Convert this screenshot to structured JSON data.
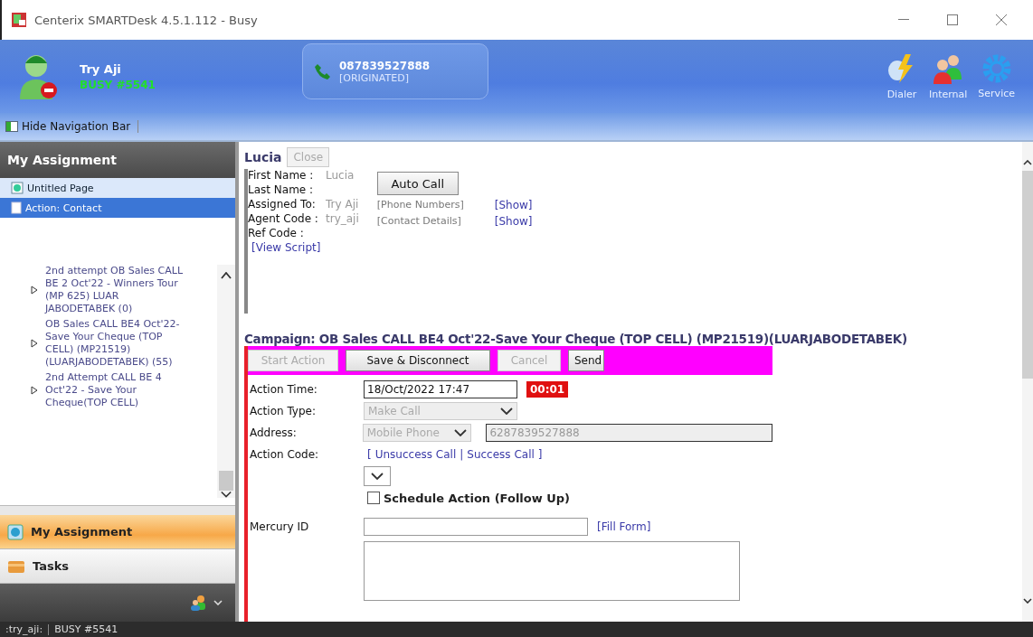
{
  "window": {
    "title": "Centerix SMARTDesk 4.5.1.112 - Busy"
  },
  "agent": {
    "name": "Try Aji",
    "status": "BUSY #5541"
  },
  "call": {
    "number": "087839527888",
    "state": "[ORIGINATED]"
  },
  "tools": [
    {
      "label": "Dialer",
      "kind": "dialer"
    },
    {
      "label": "Internal",
      "kind": "internal"
    },
    {
      "label": "Service",
      "kind": "service"
    }
  ],
  "nav_toggle": "Hide Navigation Bar",
  "sidebar": {
    "title": "My Assignment",
    "pages": [
      {
        "label": "Untitled Page",
        "kind": "page",
        "selected": false
      },
      {
        "label": "Action: Contact",
        "kind": "doc",
        "selected": true
      }
    ],
    "campaigns": [
      "2nd attempt OB Sales CALL BE 2 Oct'22 - Winners Tour (MP 625) LUAR JABODETABEK (0)",
      "OB Sales CALL BE4 Oct'22-Save Your Cheque (TOP CELL) (MP21519) (LUARJABODETABEK) (55)",
      "2nd Attempt CALL BE 4 Oct'22 - Save Your Cheque(TOP CELL)"
    ],
    "sections": [
      {
        "label": "My Assignment",
        "kind": "assignment",
        "selected": true
      },
      {
        "label": "Tasks",
        "kind": "tasks",
        "selected": false
      }
    ]
  },
  "contact": {
    "name": "Lucia",
    "close": {
      "label": "Close",
      "disabled": true
    },
    "fields": [
      {
        "label": "First Name :",
        "value": "Lucia"
      },
      {
        "label": "Last Name :"
      },
      {
        "label": "Assigned To:",
        "value": "Try Aji"
      },
      {
        "label": "Agent Code :",
        "value": "try_aji"
      },
      {
        "label": "Ref Code :"
      }
    ],
    "script_link": "[View Script]",
    "auto_call": "Auto Call",
    "details": [
      {
        "label": "[Phone Numbers]",
        "link": "[Show]"
      },
      {
        "label": "[Contact Details]",
        "link": "[Show]"
      }
    ]
  },
  "campaign": {
    "title": "Campaign: OB Sales CALL BE4 Oct'22-Save Your Cheque (TOP CELL) (MP21519)(LUARJABODETABEK)",
    "buttons": [
      {
        "label": "Start Action",
        "disabled": true,
        "kind": "narrow"
      },
      {
        "label": "Save & Disconnect",
        "disabled": false,
        "kind": "wide"
      },
      {
        "label": "Cancel",
        "disabled": true,
        "kind": "narrow"
      },
      {
        "label": "Send",
        "disabled": false,
        "kind": "small"
      }
    ],
    "action_time": {
      "label": "Action Time:",
      "value": "18/Oct/2022 17:47",
      "timer": "00:01"
    },
    "action_type": {
      "label": "Action Type:",
      "value": "Make Call",
      "disabled": true
    },
    "address": {
      "label": "Address:",
      "type": "Mobile Phone",
      "value": "6287839527888",
      "disabled": true
    },
    "action_code": {
      "label": "Action Code:",
      "open": "[",
      "links": [
        "Unsuccess Call",
        "Success Call"
      ],
      "sep": "|",
      "close": "]"
    },
    "schedule": {
      "label": "Schedule Action (Follow Up)",
      "checked": false
    },
    "mercury": {
      "label": "Mercury ID",
      "link": "[Fill Form]"
    }
  },
  "status_bar": {
    "user": ":try_aji:",
    "status": "BUSY #5541"
  }
}
